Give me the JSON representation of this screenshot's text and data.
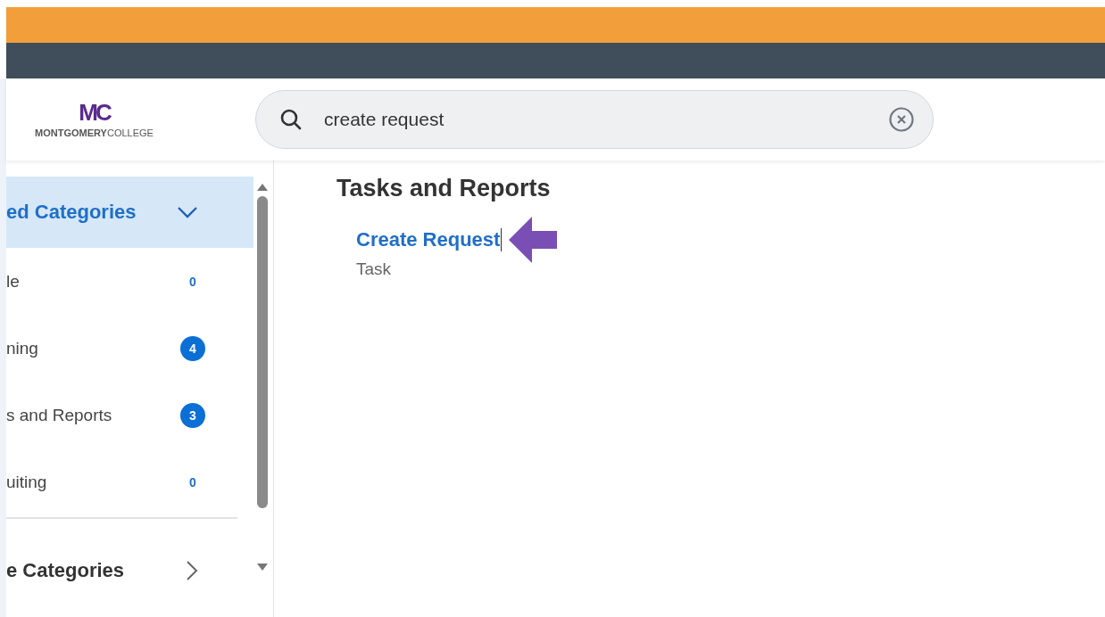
{
  "logo": {
    "mark": "MC",
    "wordmark": "**MONTGOMERY**COLLEGE"
  },
  "search": {
    "value": "create request"
  },
  "sidebar": {
    "sections": [
      {
        "title": "ed Categories",
        "expanded": true,
        "items": [
          {
            "label": "le",
            "count": "0",
            "kind": "plain"
          },
          {
            "label": "ning",
            "count": "4",
            "kind": "badge"
          },
          {
            "label": "s and Reports",
            "count": "3",
            "kind": "badge"
          },
          {
            "label": "uiting",
            "count": "0",
            "kind": "plain"
          }
        ]
      },
      {
        "title": "e Categories",
        "expanded": false
      }
    ]
  },
  "results": {
    "heading": "Tasks and Reports",
    "items": [
      {
        "title": "Create Request",
        "type": "Task"
      }
    ]
  }
}
